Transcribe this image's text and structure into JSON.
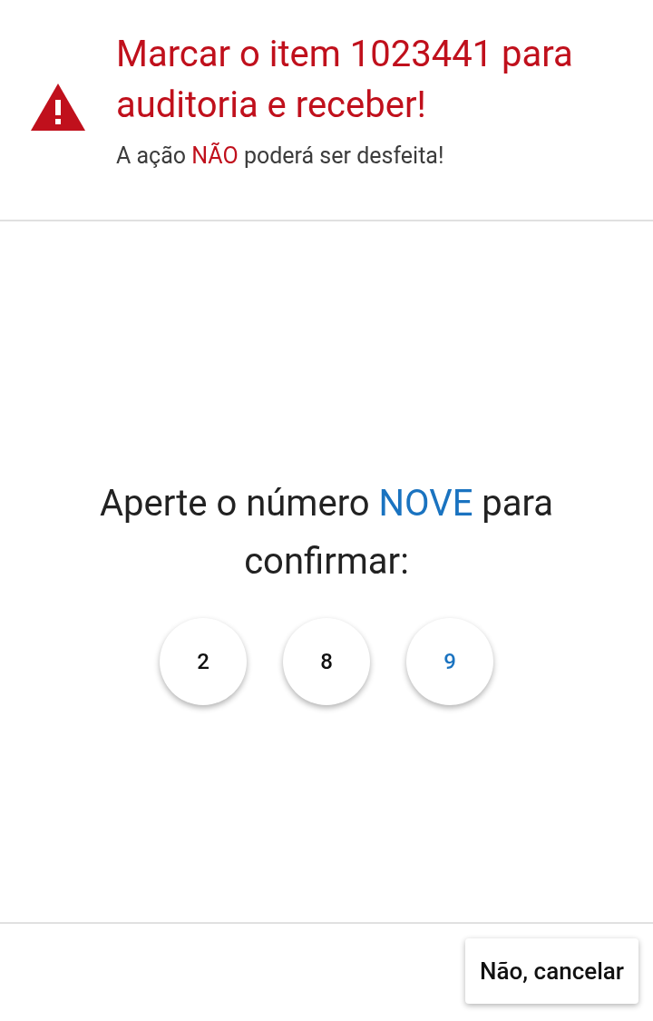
{
  "header": {
    "title": "Marcar o item 1023441 para auditoria e receber!",
    "subtitle": [
      {
        "text": "A ação ",
        "emphasis": false
      },
      {
        "text": "NÃO",
        "emphasis": true
      },
      {
        "text": " poderá ser desfeita!",
        "emphasis": false
      }
    ]
  },
  "prompt": [
    {
      "text": "Aperte o número ",
      "emphasis": false
    },
    {
      "text": "NOVE",
      "emphasis": true
    },
    {
      "text": " para confirmar:",
      "emphasis": false
    }
  ],
  "number_buttons": [
    {
      "label": "2",
      "highlighted": false
    },
    {
      "label": "8",
      "highlighted": false
    },
    {
      "label": "9",
      "highlighted": true
    }
  ],
  "footer": {
    "cancel_button": "Não, cancelar"
  }
}
